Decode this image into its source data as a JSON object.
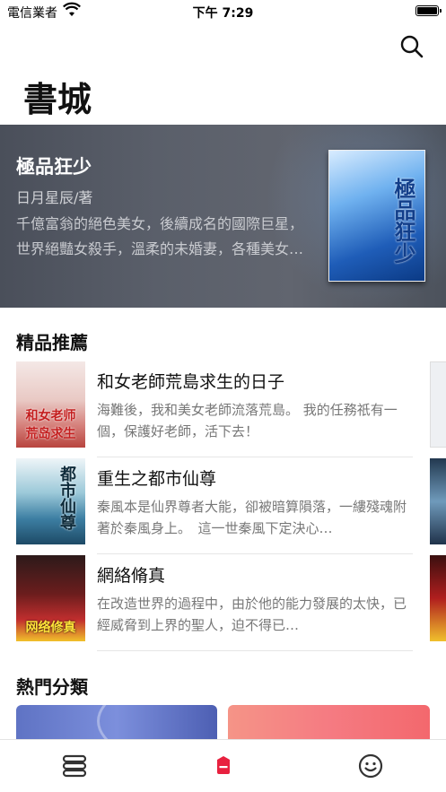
{
  "status_bar": {
    "carrier": "電信業者",
    "time": "下午 7:29"
  },
  "header": {
    "title": "書城"
  },
  "featured": {
    "title": "極品狂少",
    "author": "日月星辰/著",
    "description": "千億富翁的絕色美女，後續成名的國際巨星，世界絕豔女殺手，溫柔的未婚妻，各種美女紛至沓來……",
    "cover_text": "極品狂少"
  },
  "recommended": {
    "title": "精品推薦",
    "books": [
      {
        "name": "和女老師荒島求生的日子",
        "description": "海難後，我和美女老師流落荒島。 我的任務祇有一個，保護好老師，活下去！",
        "cover_text": "和女老师荒岛求生"
      },
      {
        "name": "重生之都市仙尊",
        "description": "秦風本是仙界尊者大能，卻被暗算隕落，一縷殘魂附著於秦風身上。　這一世秦風下定決心…",
        "cover_text": "都市仙尊"
      },
      {
        "name": "網絡脩真",
        "description": "在改造世界的過程中，由於他的能力發展的太快，已經威脅到上界的聖人，迫不得已…",
        "cover_text": "网络修真"
      }
    ]
  },
  "categories": {
    "title": "熱門分類"
  },
  "tabbar": {
    "items": [
      {
        "icon": "bookshelf-icon"
      },
      {
        "icon": "bookstore-icon",
        "active": true,
        "color": "#e8213f"
      },
      {
        "icon": "smiley-profile-icon"
      }
    ]
  }
}
